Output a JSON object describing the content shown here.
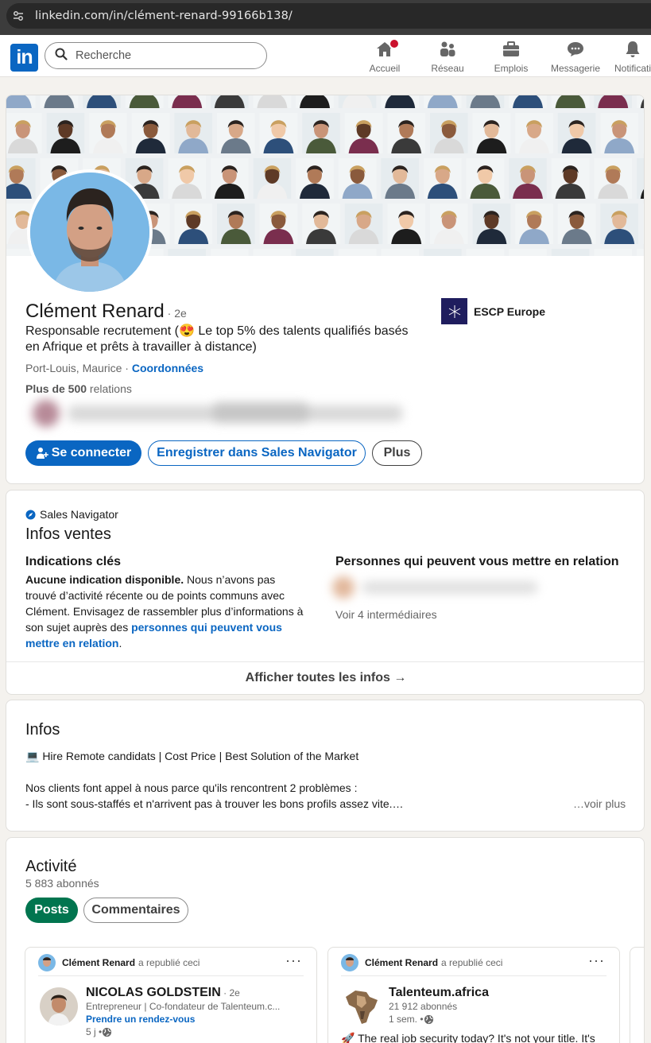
{
  "browser": {
    "url": "linkedin.com/in/clément-renard-99166b138/"
  },
  "nav": {
    "logo": "in",
    "search_placeholder": "Recherche",
    "items": [
      {
        "label": "Accueil",
        "icon": "home-icon"
      },
      {
        "label": "Réseau",
        "icon": "network-icon"
      },
      {
        "label": "Emplois",
        "icon": "briefcase-icon"
      },
      {
        "label": "Messagerie",
        "icon": "messaging-icon"
      },
      {
        "label": "Notificati",
        "icon": "bell-icon"
      }
    ]
  },
  "profile": {
    "name": "Clément Renard",
    "degree": " · 2e",
    "headline": "Responsable recrutement (😍 Le top 5% des talents qualifiés basés en Afrique et prêts à travailler à distance)",
    "location": "Port-Louis, Maurice · ",
    "contact_link": "Coordonnées",
    "relations_count": "Plus de 500",
    "relations_label": " relations",
    "school": "ESCP Europe",
    "buttons": {
      "connect": "Se connecter",
      "save": "Enregistrer dans Sales Navigator",
      "more": "Plus"
    }
  },
  "sales": {
    "brand": "Sales Navigator",
    "title": "Infos ventes",
    "insights_title": "Indications clés",
    "insights_bold": "Aucune indication disponible.",
    "insights_text": " Nous n’avons pas trouvé d’activité récente ou de points communs avec Clément. Envisagez de rassembler plus d’informations à son sujet auprès des ",
    "insights_link": "personnes qui peuvent vous mettre en relation",
    "insights_end": ".",
    "connections_title": "Personnes qui peuvent vous mettre en relation",
    "intermediaries": "Voir 4 intermédiaires",
    "show_all": "Afficher toutes les infos →"
  },
  "about": {
    "title": "Infos",
    "line1": "💻 Hire Remote candidats | Cost Price | Best Solution of the Market",
    "line2": "Nos clients font appel à nous parce qu'ils rencontrent 2 problèmes :",
    "line3": "- Ils sont sous-staffés et n'arrivent pas à trouver les bons profils assez vite.…",
    "see_more": "…voir plus"
  },
  "activity": {
    "title": "Activité",
    "followers": "5 883 abonnés",
    "tabs": [
      "Posts",
      "Commentaires"
    ],
    "posts": [
      {
        "reposter": "Clément Renard",
        "repost_label": "a republié ceci",
        "author": "NICOLAS GOLDSTEIN",
        "author_degree": " · 2e",
        "author_sub": "Entrepreneur | Co-fondateur de Talenteum.c...",
        "author_link": "Prendre un rendez-vous",
        "time": "5 j • ",
        "text": ""
      },
      {
        "reposter": "Clément Renard",
        "repost_label": "a republié ceci",
        "author": "Talenteum.africa",
        "author_degree": "",
        "author_sub": "21 912 abonnés",
        "author_link": "",
        "time": "1 sem. • ",
        "text": "🚀 The real job security today? It's not your title. It's"
      }
    ]
  },
  "colors": {
    "brand": "#0a66c2",
    "green": "#01754f",
    "badge": "#cb112d"
  }
}
